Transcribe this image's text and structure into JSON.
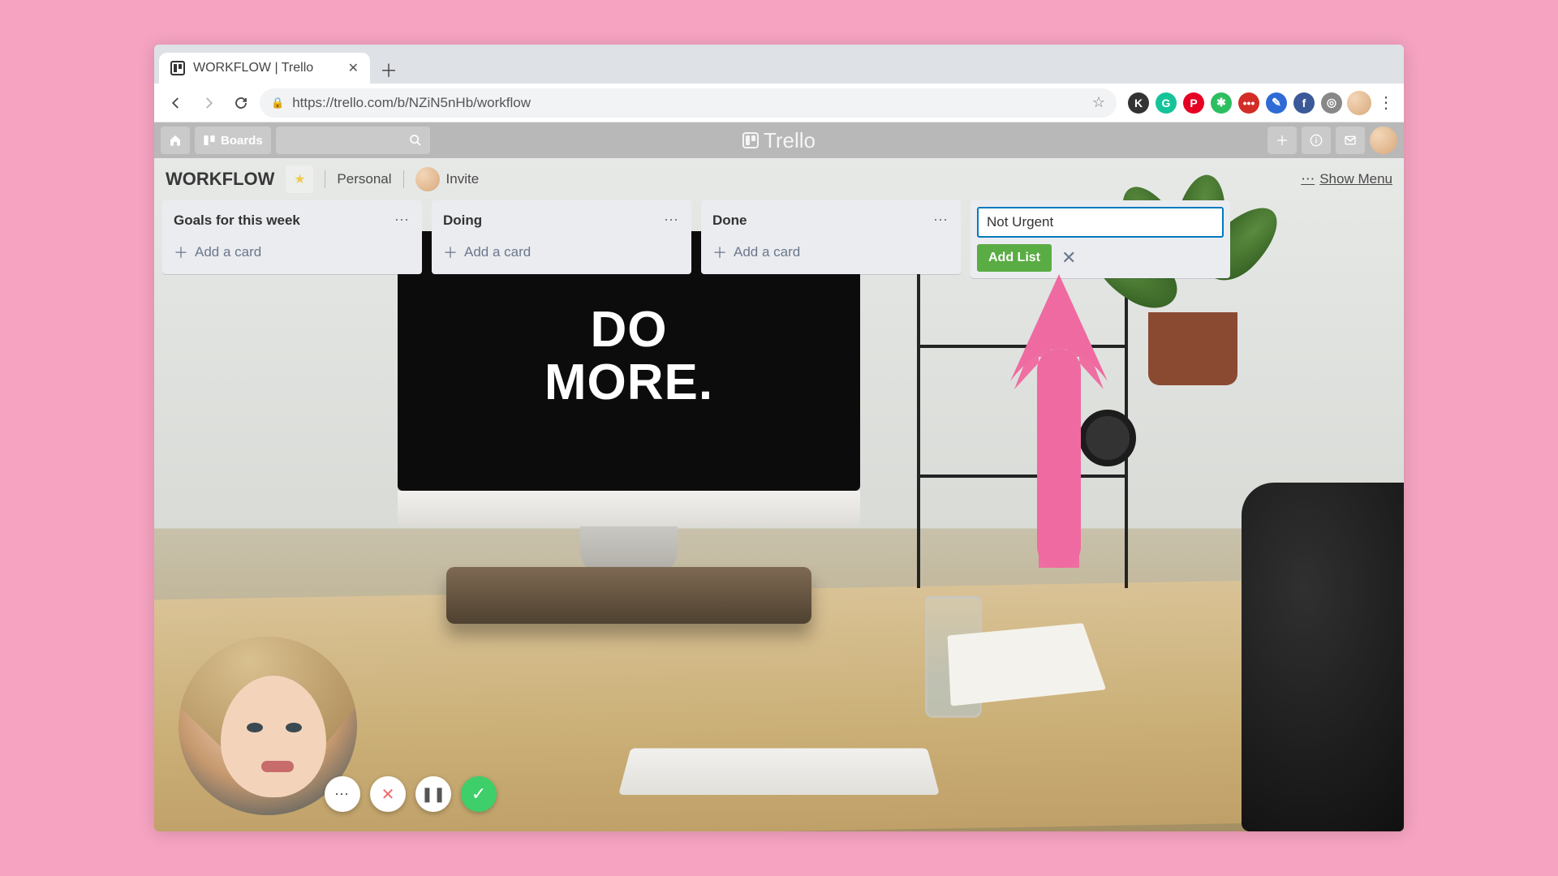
{
  "browser": {
    "tab_title": "WORKFLOW | Trello",
    "url": "https://trello.com/b/NZiN5nHb/workflow"
  },
  "extensions": [
    {
      "name": "ext-k",
      "bg": "#333",
      "label": "K"
    },
    {
      "name": "ext-grammarly",
      "bg": "#15c39a",
      "label": "G"
    },
    {
      "name": "ext-pinterest",
      "bg": "#e60023",
      "label": "P"
    },
    {
      "name": "ext-evernote",
      "bg": "#2dbe60",
      "label": "✱"
    },
    {
      "name": "ext-lastpass",
      "bg": "#d32d27",
      "label": "•••"
    },
    {
      "name": "ext-pen",
      "bg": "#2e6bd6",
      "label": "✎"
    },
    {
      "name": "ext-facebook",
      "bg": "#3b5998",
      "label": "f"
    },
    {
      "name": "ext-loom",
      "bg": "#888",
      "label": "◎"
    }
  ],
  "trello_header": {
    "boards_label": "Boards",
    "logo_text": "Trello"
  },
  "board": {
    "title": "WORKFLOW",
    "visibility": "Personal",
    "invite_label": "Invite",
    "show_menu_label": "Show Menu"
  },
  "lists": [
    {
      "title": "Goals for this week",
      "add_card": "Add a card"
    },
    {
      "title": "Doing",
      "add_card": "Add a card"
    },
    {
      "title": "Done",
      "add_card": "Add a card"
    }
  ],
  "composer": {
    "input_value": "Not Urgent",
    "add_button": "Add List"
  },
  "scene": {
    "monitor_text_line1": "DO",
    "monitor_text_line2": "MORE."
  }
}
